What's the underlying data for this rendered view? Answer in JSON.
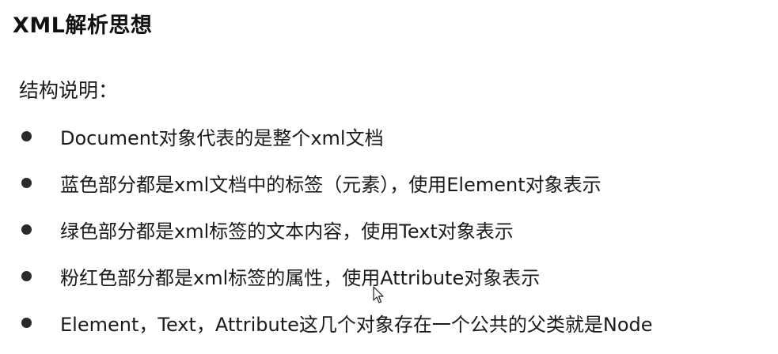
{
  "title": "XML解析思想",
  "section_label": "结构说明：",
  "bullets": [
    "Document对象代表的是整个xml文档",
    "蓝色部分都是xml文档中的标签（元素），使用Element对象表示",
    "绿色部分都是xml标签的文本内容，使用Text对象表示",
    "粉红色部分都是xml标签的属性，使用Attribute对象表示",
    "Element，Text，Attribute这几个对象存在一个公共的父类就是Node"
  ],
  "icons": {
    "bullet": "filled-circle-bullet",
    "cursor": "mouse-pointer-icon"
  },
  "colors": {
    "text": "#1a1a1a",
    "bullet": "#2a2a2a",
    "background": "#ffffff"
  }
}
